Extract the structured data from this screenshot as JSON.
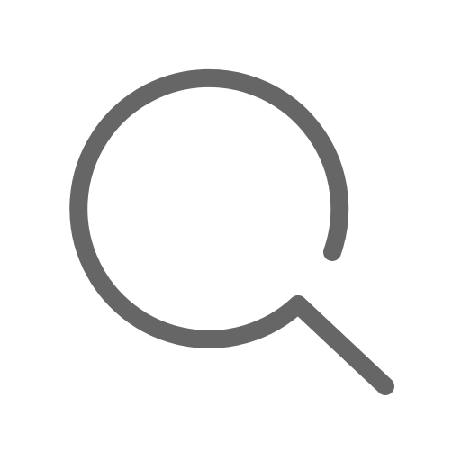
{
  "icon": {
    "name": "search-icon",
    "stroke_color": "#666666",
    "background_color": "#ffffff"
  }
}
